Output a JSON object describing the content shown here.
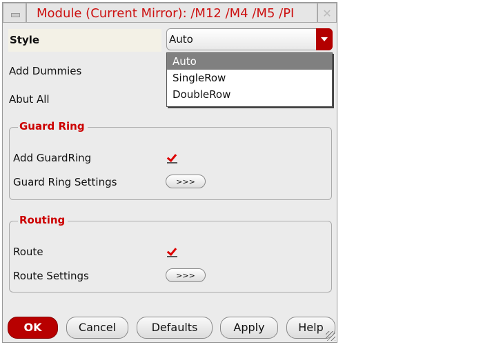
{
  "window": {
    "title": "Module (Current Mirror): /M12 /M4 /M5 /PI"
  },
  "style": {
    "label": "Style",
    "value": "Auto",
    "options": [
      "Auto",
      "SingleRow",
      "DoubleRow"
    ]
  },
  "fields": {
    "add_dummies": "Add Dummies",
    "abut_all": "Abut All"
  },
  "guard_ring": {
    "legend": "Guard Ring",
    "add_label": "Add GuardRing",
    "add_checked": true,
    "settings_label": "Guard Ring Settings",
    "settings_button": ">>>"
  },
  "routing": {
    "legend": "Routing",
    "route_label": "Route",
    "route_checked": true,
    "settings_label": "Route Settings",
    "settings_button": ">>>"
  },
  "buttons": {
    "ok": "OK",
    "cancel": "Cancel",
    "defaults": "Defaults",
    "apply": "Apply",
    "help": "Help"
  },
  "colors": {
    "accent": "#b80000",
    "title": "#cc1111"
  }
}
